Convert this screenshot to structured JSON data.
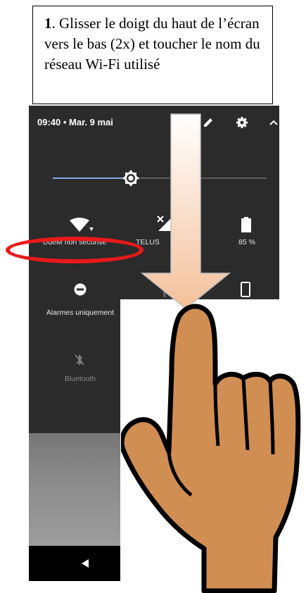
{
  "instruction": {
    "step_number": "1",
    "text": ". Glisser le doigt du haut de l’écran vers le bas (2x) et toucher le nom du réseau Wi-Fi utilisé"
  },
  "status_bar": {
    "time": "09:40 • Mar. 9 mai",
    "icons": [
      "edit-pencil-icon",
      "settings-gear-icon",
      "collapse-chevron-icon"
    ]
  },
  "brightness": {
    "level_fraction": 0.4
  },
  "tiles": [
    {
      "id": "wifi",
      "label": "UdeM non securise",
      "icon": "wifi-icon"
    },
    {
      "id": "mobile",
      "label": "TELUS",
      "icon": "cellular-signal-icon"
    },
    {
      "id": "battery",
      "label": "85 %",
      "icon": "battery-icon"
    },
    {
      "id": "dnd",
      "label": "Alarmes uniquement",
      "icon": "do-not-disturb-icon"
    },
    {
      "id": "flashlight",
      "label": "",
      "icon": "flashlight-off-icon"
    },
    {
      "id": "rotate",
      "label": "",
      "icon": "phone-portrait-icon"
    },
    {
      "id": "bluetooth",
      "label": "Bluetooth",
      "icon": "bluetooth-off-icon"
    }
  ],
  "colors": {
    "highlight_ring": "#e8191a",
    "panel_bg": "#2b2b2b",
    "slider_accent": "#7da9e8",
    "hand_fill": "#d08e52",
    "arrow_fill": "#f6c9a6"
  },
  "navbar": {
    "icons": [
      "back-triangle-icon"
    ]
  }
}
